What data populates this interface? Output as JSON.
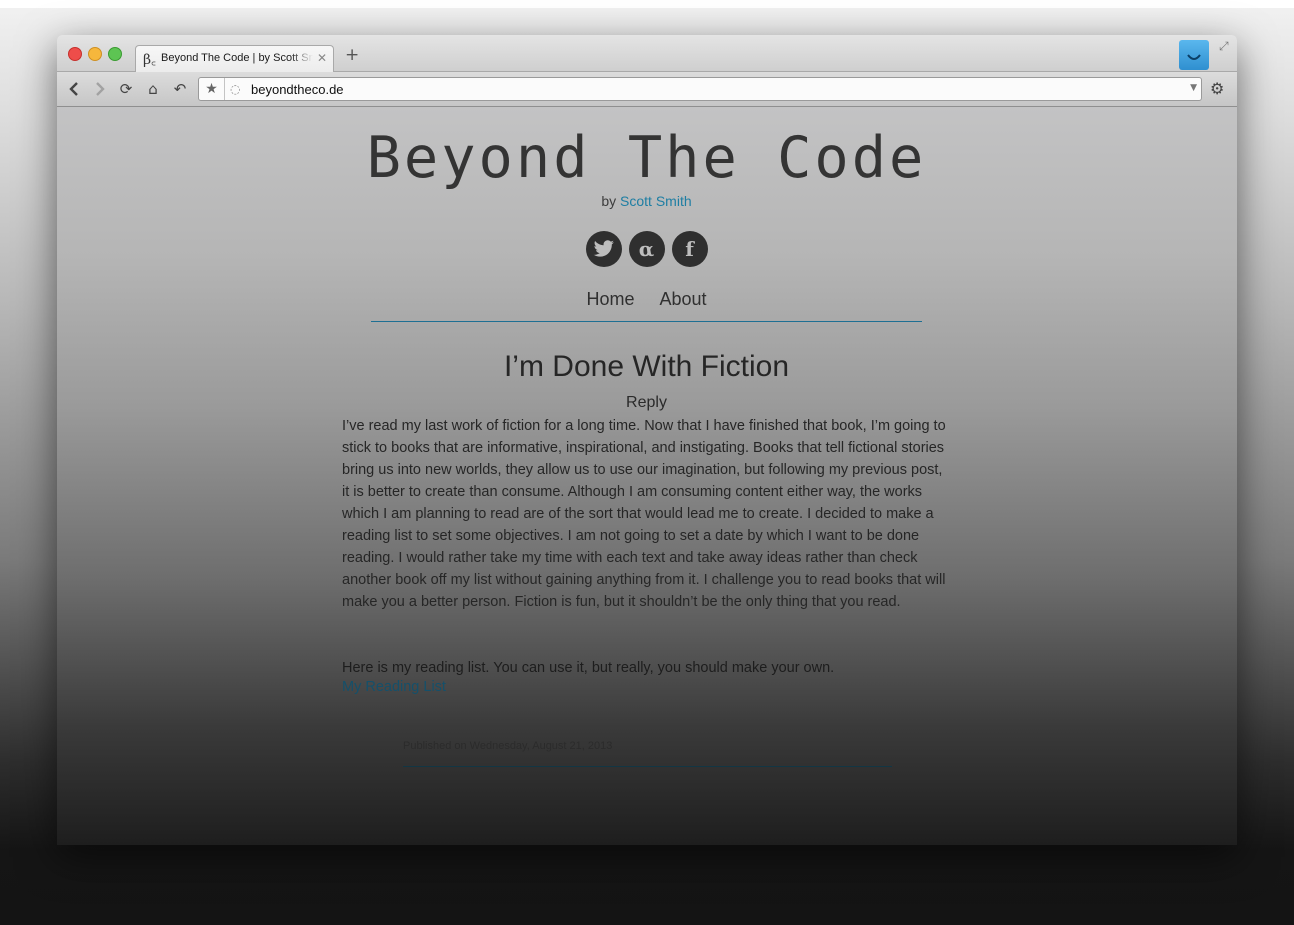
{
  "browser": {
    "tab": {
      "favicon": "β꜀",
      "title": "Beyond The Code | by Scott Smith"
    },
    "url": "beyondtheco.de",
    "icons": [
      "back-icon",
      "forward-icon",
      "reload-icon",
      "home-icon",
      "undo-icon",
      "star-icon",
      "page-icon",
      "wrench-icon",
      "fullscreen-icon",
      "extension-icon"
    ]
  },
  "site": {
    "title": "Beyond The Code",
    "by_prefix": "by",
    "author": "Scott Smith",
    "social": [
      "twitter-icon",
      "appnet-icon",
      "facebook-icon"
    ],
    "nav": [
      "Home",
      "About"
    ]
  },
  "post": {
    "title": "I’m Done With Fiction",
    "reply": "Reply",
    "paragraph1": "I’ve read my last work of fiction for a long time. Now that I have finished that book, I’m going to stick to books that are informative, inspirational, and instigating. Books that tell fictional stories bring us into new worlds, they allow us to use our imagination, but following my previous post, it is better to create than consume. Although I am consuming content either way, the works which I am planning to read are of the sort that would lead me to create. I decided to make a reading list to set some objectives. I am not going to set a date by which I want to be done reading. I would rather take my time with each text and take away ideas rather than check another book off my list without gaining anything from it. I challenge you to read books that will make you a better person. Fiction is fun, but it shouldn’t be the only thing that you read.",
    "paragraph2": "Here is my reading list. You can use it, but really, you should make your own.",
    "link": "My Reading List",
    "meta": "Published on Wednesday, August 21, 2013"
  },
  "colors": {
    "link": "#1e7ea3",
    "rule": "#1e6f93",
    "social_bg": "#2f2f2f"
  }
}
